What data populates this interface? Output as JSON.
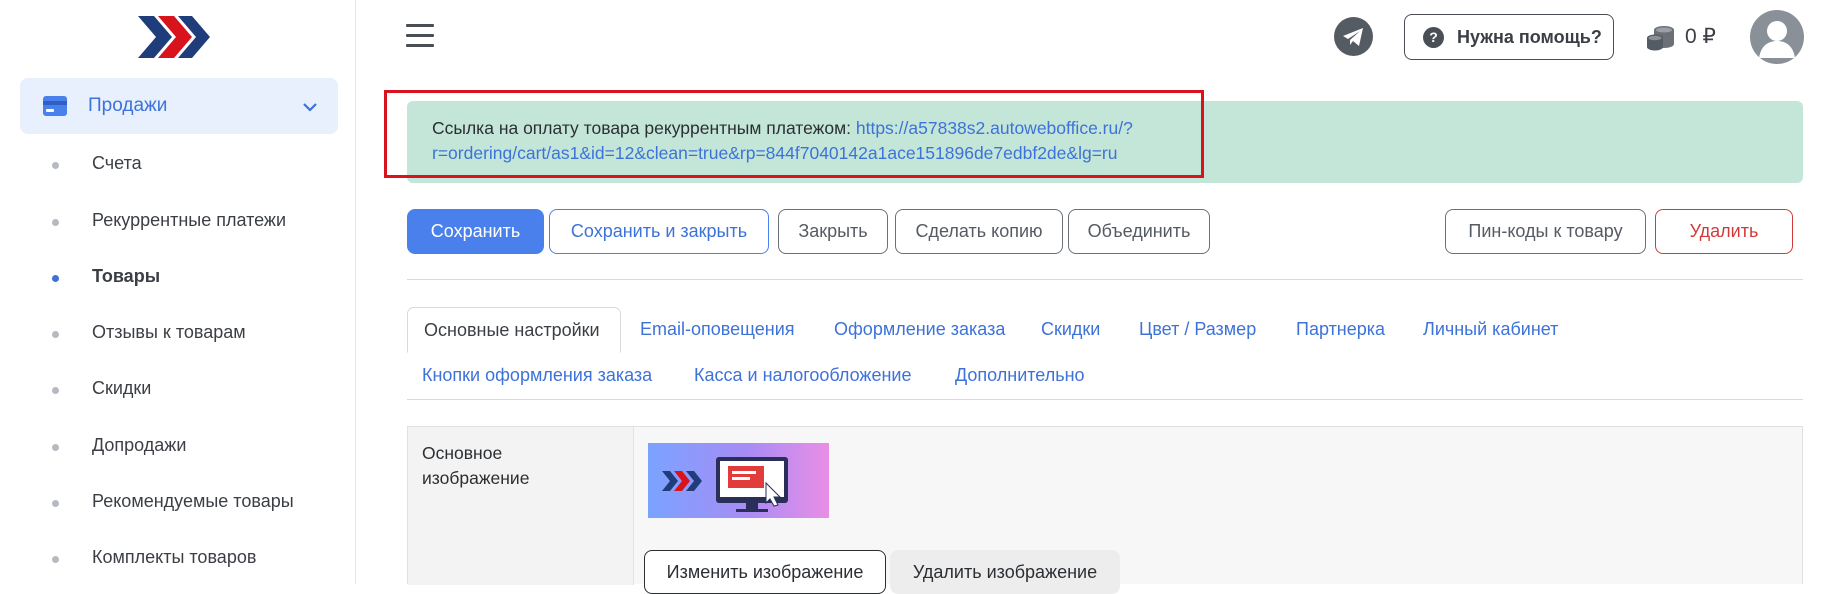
{
  "sidebar": {
    "group": {
      "label": "Продажи",
      "icon": "credit-card-icon",
      "expand_icon": "chevron-down-icon"
    },
    "items": [
      {
        "label": "Счета",
        "active": false
      },
      {
        "label": "Рекуррентные платежи",
        "active": false
      },
      {
        "label": "Товары",
        "active": true
      },
      {
        "label": "Отзывы к товарам",
        "active": false
      },
      {
        "label": "Скидки",
        "active": false
      },
      {
        "label": "Допродажи",
        "active": false
      },
      {
        "label": "Рекомендуемые товары",
        "active": false
      },
      {
        "label": "Комплекты товаров",
        "active": false
      }
    ]
  },
  "header": {
    "help_label": "Нужна помощь?",
    "balance": "0 ₽"
  },
  "alert": {
    "text": "Ссылка на оплату товара рекуррентным платежом: ",
    "link": "https://a57838s2.autoweboffice.ru/?r=ordering/cart/as1&id=12&clean=true&rp=844f7040142a1ace151896de7edbf2de&lg=ru",
    "link_line1": "https://a57838s2.autoweboffice.ru/?",
    "link_line2": "r=ordering/cart/as1&id=12&clean=true&rp=844f7040142a1ace151896de7edbf2de&lg=ru"
  },
  "toolbar": {
    "save": "Сохранить",
    "save_close": "Сохранить и закрыть",
    "close": "Закрыть",
    "copy": "Сделать копию",
    "merge": "Объединить",
    "pins": "Пин-коды к товару",
    "delete": "Удалить"
  },
  "tabs": [
    "Основные настройки",
    "Email-оповещения",
    "Оформление заказа",
    "Скидки",
    "Цвет / Размер",
    "Партнерка",
    "Личный кабинет",
    "Кнопки оформления заказа",
    "Касса и налогообложение",
    "Дополнительно"
  ],
  "form": {
    "image_label": "Основное изображение",
    "change_image": "Изменить изображение",
    "delete_image": "Удалить изображение"
  },
  "colors": {
    "accent": "#4a80ec",
    "link": "#3d72d9",
    "alert_bg": "#c3e6d8",
    "danger": "#d23a3a",
    "highlight_box": "#d8131b"
  }
}
